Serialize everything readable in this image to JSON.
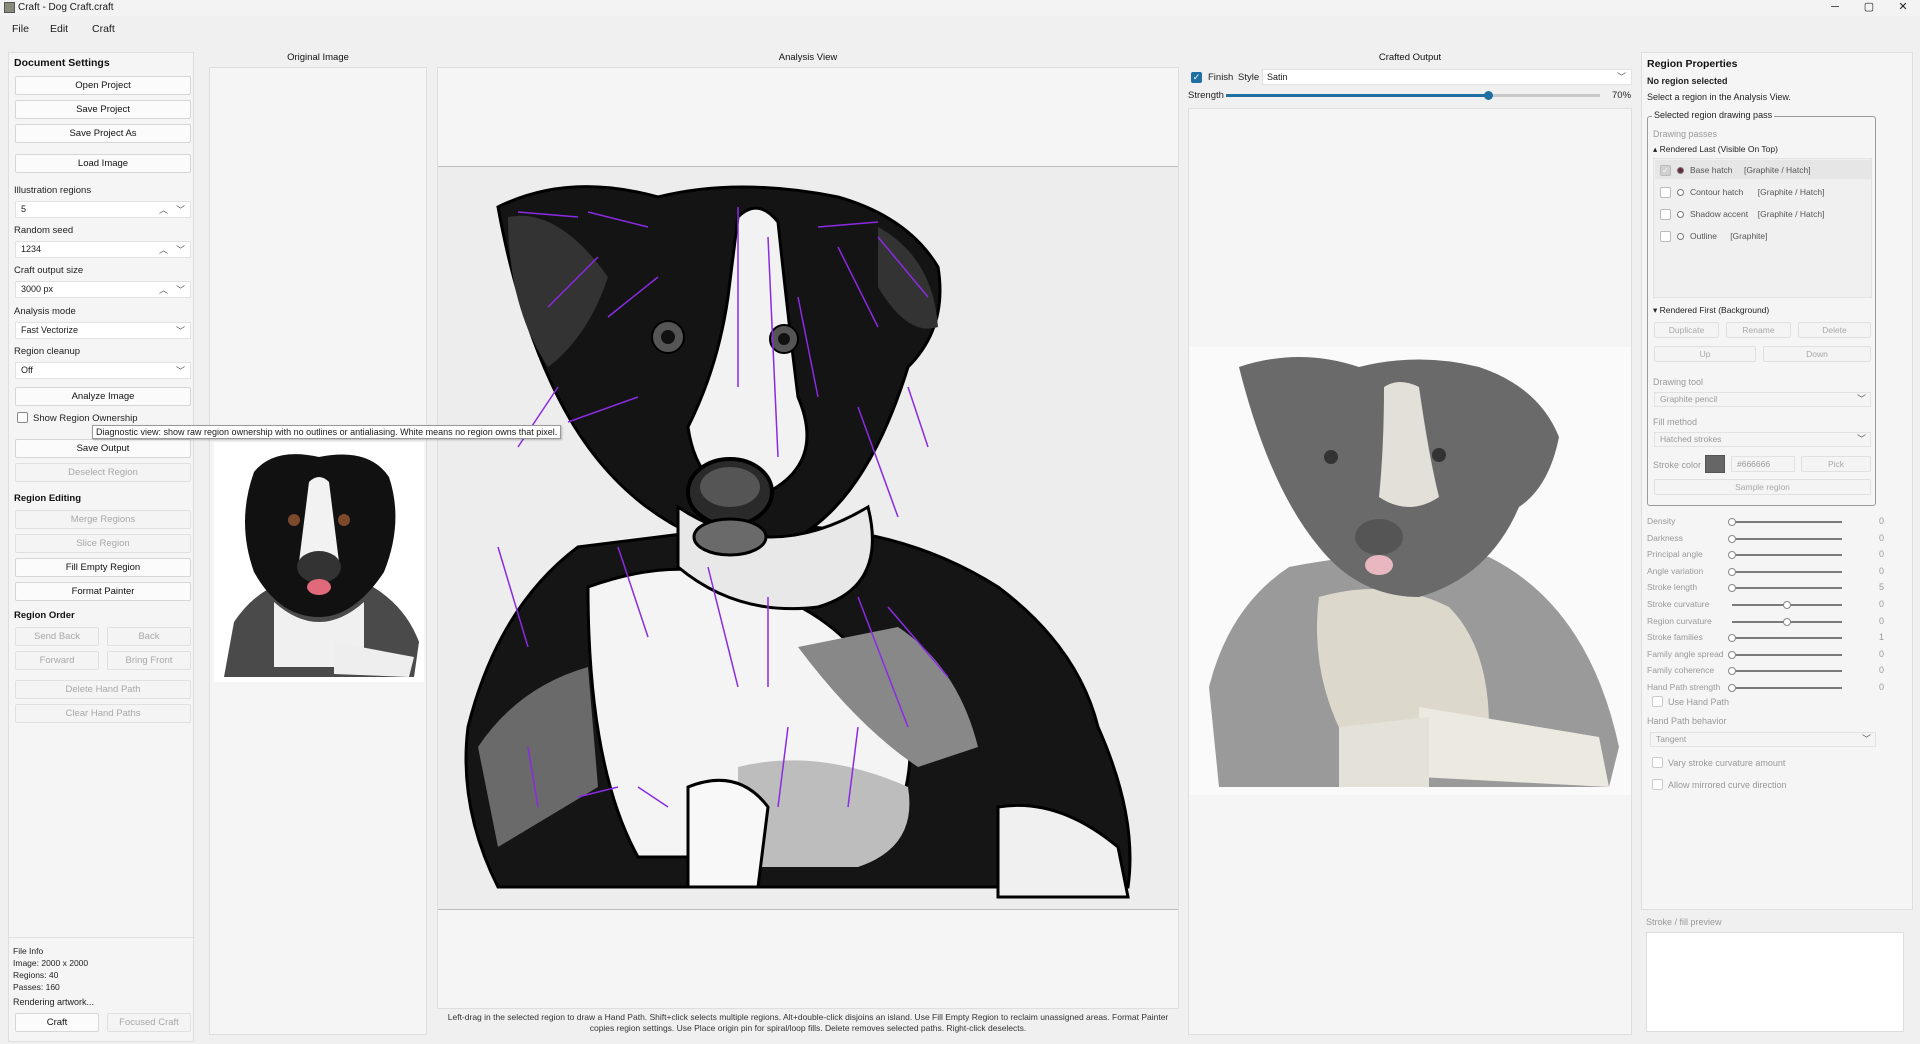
{
  "window": {
    "title": "Craft - Dog Craft.craft",
    "minimize": "─",
    "maximize": "▢",
    "close": "✕"
  },
  "menu": [
    "File",
    "Edit",
    "Craft"
  ],
  "left": {
    "title": "Document Settings",
    "open_project": "Open Project",
    "save_project": "Save Project",
    "save_project_as": "Save Project As",
    "load_image": "Load Image",
    "regions_label": "Illustration regions",
    "regions_value": "5",
    "seed_label": "Random seed",
    "seed_value": "1234",
    "size_label": "Craft output size",
    "size_value": "3000 px",
    "mode_label": "Analysis mode",
    "mode_value": "Fast Vectorize",
    "cleanup_label": "Region cleanup",
    "cleanup_value": "Off",
    "analyze": "Analyze Image",
    "show_ownership": "Show Region Ownership",
    "tooltip": "Diagnostic view: show raw region ownership with no outlines or antialiasing. White means no region owns that pixel.",
    "save_output": "Save Output",
    "deselect": "Deselect Region",
    "editing_title": "Region Editing",
    "merge": "Merge Regions",
    "slice": "Slice Region",
    "fill_empty": "Fill Empty Region",
    "format_painter": "Format Painter",
    "order_title": "Region Order",
    "send_back": "Send Back",
    "back": "Back",
    "forward": "Forward",
    "bring_front": "Bring Front",
    "delete_hand": "Delete Hand Path",
    "clear_hand": "Clear Hand Paths",
    "file_info": {
      "title": "File Info",
      "image": "Image: 2000 x 2000",
      "regions": "Regions: 40",
      "passes": "Passes: 160"
    },
    "status": "Rendering artwork...",
    "craft": "Craft",
    "focused_craft": "Focused Craft"
  },
  "columns": {
    "original": "Original Image",
    "analysis": "Analysis View",
    "crafted": "Crafted Output"
  },
  "crafted": {
    "finish_label": "Finish",
    "style_label": "Style",
    "style_value": "Satin",
    "strength_label": "Strength",
    "strength_value": "70%",
    "strength_fraction": 0.7
  },
  "analysis_hint": "Left-drag in the selected region to draw a Hand Path. Shift+click selects multiple regions. Alt+double-click disjoins an island. Use Fill Empty Region to reclaim unassigned areas. Format Painter copies region settings. Use Place origin pin for spiral/loop fills. Delete removes selected paths. Right-click deselects.",
  "right": {
    "title": "Region Properties",
    "no_selection": "No region selected",
    "hint": "Select a region in the Analysis View.",
    "group_title": "Selected region drawing pass",
    "passes_label": "Drawing passes",
    "last_header": "▴ Rendered Last (Visible On Top)",
    "passes": [
      {
        "name": "Base hatch",
        "tag": "[Graphite / Hatch]",
        "checked": true
      },
      {
        "name": "Contour hatch",
        "tag": "[Graphite / Hatch]",
        "checked": false
      },
      {
        "name": "Shadow accent",
        "tag": "[Graphite / Hatch]",
        "checked": false
      },
      {
        "name": "Outline",
        "tag": "[Graphite]",
        "checked": false
      }
    ],
    "first_header": "▾ Rendered First (Background)",
    "duplicate": "Duplicate",
    "rename": "Rename",
    "delete": "Delete",
    "up": "Up",
    "down": "Down",
    "tool_label": "Drawing tool",
    "tool_value": "Graphite pencil",
    "fill_label": "Fill method",
    "fill_value": "Hatched strokes",
    "stroke_color_label": "Stroke color",
    "stroke_color_value": "#666666",
    "pick": "Pick",
    "sample": "Sample region",
    "sliders": [
      {
        "label": "Density",
        "value": "0",
        "pos": 0
      },
      {
        "label": "Darkness",
        "value": "0",
        "pos": 0
      },
      {
        "label": "Principal angle",
        "value": "0",
        "pos": 0
      },
      {
        "label": "Angle variation",
        "value": "0",
        "pos": 0
      },
      {
        "label": "Stroke length",
        "value": "5",
        "pos": 0
      },
      {
        "label": "Stroke curvature",
        "value": "0",
        "pos": 0.5
      },
      {
        "label": "Region curvature",
        "value": "0",
        "pos": 0.5
      },
      {
        "label": "Stroke families",
        "value": "1",
        "pos": 0
      },
      {
        "label": "Family angle spread",
        "value": "0",
        "pos": 0
      },
      {
        "label": "Family coherence",
        "value": "0",
        "pos": 0
      },
      {
        "label": "Hand Path strength",
        "value": "0",
        "pos": 0
      }
    ],
    "use_hand_path": "Use Hand Path",
    "hand_behavior_label": "Hand Path behavior",
    "hand_behavior_value": "Tangent",
    "vary_curvature": "Vary stroke curvature amount",
    "mirrored": "Allow mirrored curve direction",
    "preview_label": "Stroke / fill preview"
  },
  "colors": {
    "accent": "#1f6fa3",
    "purple": "#8a2be2"
  }
}
